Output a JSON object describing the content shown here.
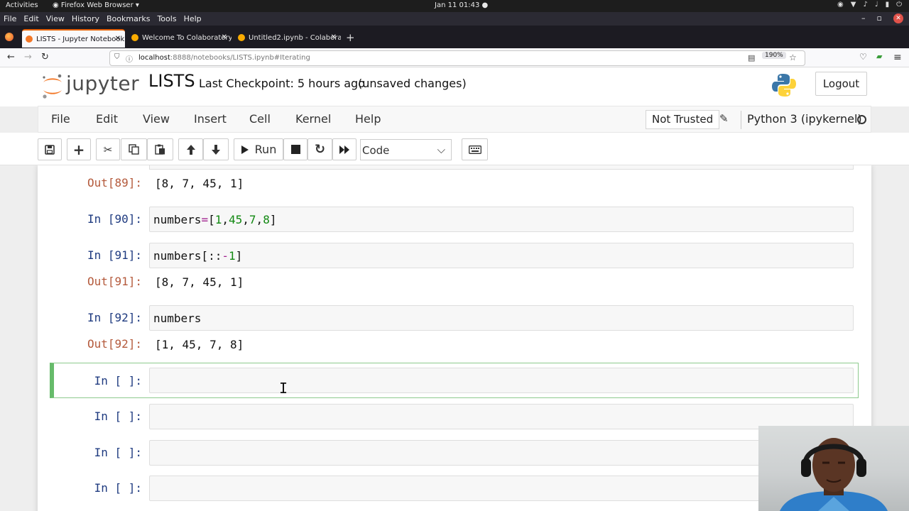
{
  "system": {
    "activities": "Activities",
    "app_name": "Firefox Web Browser",
    "clock": "Jan 11  01:43"
  },
  "firefox_menu": [
    "File",
    "Edit",
    "View",
    "History",
    "Bookmarks",
    "Tools",
    "Help"
  ],
  "tabs": [
    {
      "title": "LISTS - Jupyter Notebook"
    },
    {
      "title": "Welcome To Colaboratory"
    },
    {
      "title": "Untitled2.ipynb - Colabora"
    }
  ],
  "url": {
    "host": "localhost",
    "path": ":8888/notebooks/LISTS.ipynb#Iterating"
  },
  "zoom": "190%",
  "jupyter": {
    "logo_text": "jupyter",
    "notebook_title": "LISTS",
    "checkpoint": "Last Checkpoint: 5 hours ago",
    "unsaved": "(unsaved changes)",
    "logout": "Logout",
    "menu": [
      "File",
      "Edit",
      "View",
      "Insert",
      "Cell",
      "Kernel",
      "Help"
    ],
    "trust": "Not Trusted",
    "kernel": "Python 3 (ipykernel)",
    "run_label": "Run",
    "cell_type": "Code"
  },
  "cells": [
    {
      "out_prompt": "Out[89]:",
      "output": "[8, 7, 45, 1]"
    },
    {
      "in_prompt": "In [90]:",
      "code_parts": [
        "numbers",
        "=",
        "[",
        "1",
        ",",
        "45",
        ",",
        "7",
        ",",
        "8",
        "]"
      ]
    },
    {
      "in_prompt": "In [91]:",
      "code_parts": [
        "numbers[::",
        "-",
        "1",
        "]"
      ],
      "out_prompt": "Out[91]:",
      "output": "[8, 7, 45, 1]"
    },
    {
      "in_prompt": "In [92]:",
      "code": "numbers",
      "out_prompt": "Out[92]:",
      "output": "[1, 45, 7, 8]"
    },
    {
      "in_prompt": "In [ ]:"
    },
    {
      "in_prompt": "In [ ]:"
    },
    {
      "in_prompt": "In [ ]:"
    },
    {
      "in_prompt": "In [ ]:"
    }
  ],
  "colors": {
    "selected_cell_border": "#66bb6a",
    "in_prompt": "#1f3b80",
    "out_prompt": "#b45a3c",
    "number": "#118811",
    "operator": "#a2228f"
  }
}
